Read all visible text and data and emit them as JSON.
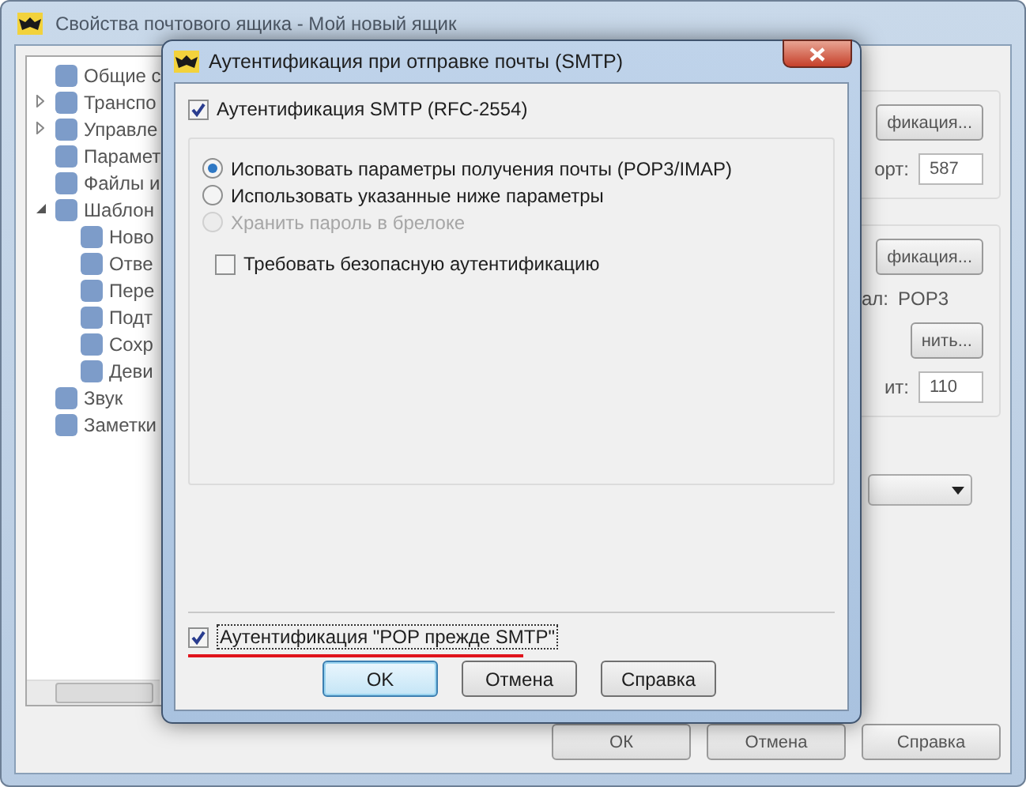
{
  "background_window": {
    "title": "Свойства почтового ящика - Мой новый ящик",
    "tree": [
      {
        "label": "Общие с"
      },
      {
        "label": "Транспо",
        "expanded": false
      },
      {
        "label": "Управле",
        "expanded": false
      },
      {
        "label": "Парамет"
      },
      {
        "label": "Файлы и"
      },
      {
        "label": "Шаблон",
        "expanded": true,
        "children": [
          {
            "label": "Ново"
          },
          {
            "label": "Отве"
          },
          {
            "label": "Пере"
          },
          {
            "label": "Подт"
          },
          {
            "label": "Сохр"
          },
          {
            "label": "Деви"
          }
        ]
      },
      {
        "label": "Звук"
      },
      {
        "label": "Заметки"
      }
    ],
    "groups": [
      [
        {
          "kind": "button",
          "label": "фикация..."
        },
        {
          "kind": "field",
          "label": "орт:",
          "value": "587"
        }
      ],
      [
        {
          "kind": "button",
          "label": "фикация..."
        },
        {
          "kind": "info",
          "label": "ал:",
          "value": "POP3"
        },
        {
          "kind": "button",
          "label": "нить..."
        },
        {
          "kind": "field",
          "label": "ит:",
          "value": "110"
        }
      ]
    ],
    "buttons": [
      "ОК",
      "Отмена",
      "Справка"
    ]
  },
  "dialog": {
    "title": "Аутентификация при отправке почты (SMTP)",
    "smtp_auth": {
      "label": "Аутентификация SMTP (RFC-2554)",
      "checked": true
    },
    "options": [
      {
        "label": "Использовать параметры получения почты (POP3/IMAP)",
        "selected": true,
        "disabled": false
      },
      {
        "label": "Использовать указанные ниже параметры",
        "selected": false,
        "disabled": false
      },
      {
        "label": "Хранить пароль в брелоке",
        "selected": false,
        "disabled": true
      }
    ],
    "secure_auth": {
      "label": "Требовать безопасную аутентификацию",
      "checked": false
    },
    "pop_before_smtp": {
      "label": "Аутентификация \"POP прежде SMTP\"",
      "checked": true,
      "highlighted": true
    },
    "buttons": [
      {
        "label": "OK",
        "default": true
      },
      {
        "label": "Отмена",
        "default": false
      },
      {
        "label": "Справка",
        "default": false
      }
    ]
  }
}
